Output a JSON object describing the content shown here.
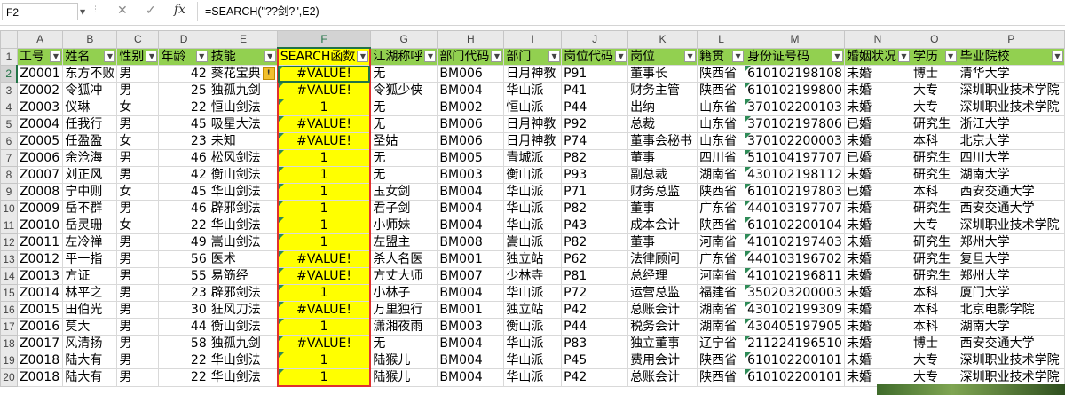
{
  "formula_bar": {
    "name_box": "F2",
    "formula": "=SEARCH(\"??剑?\",E2)",
    "cancel_icon": "close-icon",
    "confirm_icon": "check-icon",
    "fx_label": "fx"
  },
  "columns": [
    "A",
    "B",
    "C",
    "D",
    "E",
    "F",
    "G",
    "H",
    "I",
    "J",
    "K",
    "L",
    "M",
    "N",
    "O",
    "P"
  ],
  "headers": [
    "工号",
    "姓名",
    "性别",
    "年龄",
    "技能",
    "SEARCH函数",
    "江湖称呼",
    "部门代码",
    "部门",
    "岗位代码",
    "岗位",
    "籍贯",
    "身份证号码",
    "婚姻状况",
    "学历",
    "毕业院校"
  ],
  "rows": [
    {
      "n": "2",
      "cells": [
        "Z0001",
        "东方不败",
        "男",
        "42",
        "葵花宝典",
        "#VALUE!",
        "无",
        "BM006",
        "日月神教",
        "P91",
        "董事长",
        "陕西省",
        "610102198108",
        "未婚",
        "博士",
        "清华大学"
      ]
    },
    {
      "n": "3",
      "cells": [
        "Z0002",
        "令狐冲",
        "男",
        "25",
        "独孤九剑",
        "#VALUE!",
        "令狐少侠",
        "BM004",
        "华山派",
        "P41",
        "财务主管",
        "陕西省",
        "610102199800",
        "未婚",
        "大专",
        "深圳职业技术学院"
      ]
    },
    {
      "n": "4",
      "cells": [
        "Z0003",
        "仪琳",
        "女",
        "22",
        "恒山剑法",
        "1",
        "无",
        "BM002",
        "恒山派",
        "P44",
        "出纳",
        "山东省",
        "370102200103",
        "未婚",
        "大专",
        "深圳职业技术学院"
      ]
    },
    {
      "n": "5",
      "cells": [
        "Z0004",
        "任我行",
        "男",
        "45",
        "吸星大法",
        "#VALUE!",
        "无",
        "BM006",
        "日月神教",
        "P92",
        "总裁",
        "山东省",
        "370102197806",
        "已婚",
        "研究生",
        "浙江大学"
      ]
    },
    {
      "n": "6",
      "cells": [
        "Z0005",
        "任盈盈",
        "女",
        "23",
        "未知",
        "#VALUE!",
        "圣姑",
        "BM006",
        "日月神教",
        "P74",
        "董事会秘书",
        "山东省",
        "370102200003",
        "未婚",
        "本科",
        "北京大学"
      ]
    },
    {
      "n": "7",
      "cells": [
        "Z0006",
        "余沧海",
        "男",
        "46",
        "松风剑法",
        "1",
        "无",
        "BM005",
        "青城派",
        "P82",
        "董事",
        "四川省",
        "510104197707",
        "已婚",
        "研究生",
        "四川大学"
      ]
    },
    {
      "n": "8",
      "cells": [
        "Z0007",
        "刘正风",
        "男",
        "42",
        "衡山剑法",
        "1",
        "无",
        "BM003",
        "衡山派",
        "P93",
        "副总裁",
        "湖南省",
        "430102198112",
        "未婚",
        "研究生",
        "湖南大学"
      ]
    },
    {
      "n": "9",
      "cells": [
        "Z0008",
        "宁中则",
        "女",
        "45",
        "华山剑法",
        "1",
        "玉女剑",
        "BM004",
        "华山派",
        "P71",
        "财务总监",
        "陕西省",
        "610102197803",
        "已婚",
        "本科",
        "西安交通大学"
      ]
    },
    {
      "n": "10",
      "cells": [
        "Z0009",
        "岳不群",
        "男",
        "46",
        "辟邪剑法",
        "1",
        "君子剑",
        "BM004",
        "华山派",
        "P82",
        "董事",
        "广东省",
        "440103197707",
        "未婚",
        "研究生",
        "西安交通大学"
      ]
    },
    {
      "n": "11",
      "cells": [
        "Z0010",
        "岳灵珊",
        "女",
        "22",
        "华山剑法",
        "1",
        "小师妹",
        "BM004",
        "华山派",
        "P43",
        "成本会计",
        "陕西省",
        "610102200104",
        "未婚",
        "大专",
        "深圳职业技术学院"
      ]
    },
    {
      "n": "12",
      "cells": [
        "Z0011",
        "左冷禅",
        "男",
        "49",
        "嵩山剑法",
        "1",
        "左盟主",
        "BM008",
        "嵩山派",
        "P82",
        "董事",
        "河南省",
        "410102197403",
        "未婚",
        "研究生",
        "郑州大学"
      ]
    },
    {
      "n": "13",
      "cells": [
        "Z0012",
        "平一指",
        "男",
        "56",
        "医术",
        "#VALUE!",
        "杀人名医",
        "BM001",
        "独立站",
        "P62",
        "法律顾问",
        "广东省",
        "440103196702",
        "未婚",
        "研究生",
        "复旦大学"
      ]
    },
    {
      "n": "14",
      "cells": [
        "Z0013",
        "方证",
        "男",
        "55",
        "易筋经",
        "#VALUE!",
        "方丈大师",
        "BM007",
        "少林寺",
        "P81",
        "总经理",
        "河南省",
        "410102196811",
        "未婚",
        "研究生",
        "郑州大学"
      ]
    },
    {
      "n": "15",
      "cells": [
        "Z0014",
        "林平之",
        "男",
        "23",
        "辟邪剑法",
        "1",
        "小林子",
        "BM004",
        "华山派",
        "P72",
        "运营总监",
        "福建省",
        "350203200003",
        "未婚",
        "本科",
        "厦门大学"
      ]
    },
    {
      "n": "16",
      "cells": [
        "Z0015",
        "田伯光",
        "男",
        "30",
        "狂风刀法",
        "#VALUE!",
        "万里独行",
        "BM001",
        "独立站",
        "P42",
        "总账会计",
        "湖南省",
        "430102199309",
        "未婚",
        "本科",
        "北京电影学院"
      ]
    },
    {
      "n": "17",
      "cells": [
        "Z0016",
        "莫大",
        "男",
        "44",
        "衡山剑法",
        "1",
        "潇湘夜雨",
        "BM003",
        "衡山派",
        "P44",
        "税务会计",
        "湖南省",
        "430405197905",
        "未婚",
        "本科",
        "湖南大学"
      ]
    },
    {
      "n": "18",
      "cells": [
        "Z0017",
        "风清扬",
        "男",
        "58",
        "独孤九剑",
        "#VALUE!",
        "无",
        "BM004",
        "华山派",
        "P83",
        "独立董事",
        "辽宁省",
        "211224196510",
        "未婚",
        "博士",
        "西安交通大学"
      ]
    },
    {
      "n": "19",
      "cells": [
        "Z0018",
        "陆大有",
        "男",
        "22",
        "华山剑法",
        "1",
        "陆猴儿",
        "BM004",
        "华山派",
        "P45",
        "费用会计",
        "陕西省",
        "610102200101",
        "未婚",
        "大专",
        "深圳职业技术学院"
      ]
    },
    {
      "n": "20",
      "cells": [
        "Z0018",
        "陆大有",
        "男",
        "22",
        "华山剑法",
        "1",
        "陆猴儿",
        "BM004",
        "华山派",
        "P42",
        "总账会计",
        "陕西省",
        "610102200101",
        "未婚",
        "大专",
        "深圳职业技术学院"
      ]
    }
  ]
}
